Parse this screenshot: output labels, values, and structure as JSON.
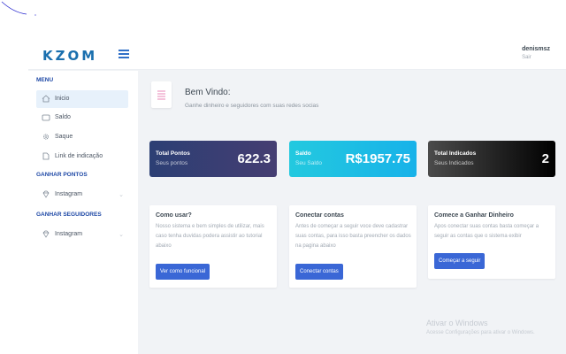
{
  "header": {
    "logo": "KZOM",
    "user_name": "denismsz",
    "user_exit": "Sair"
  },
  "sidebar": {
    "section_menu": "MENU",
    "menu_items": [
      {
        "label": "Inicio",
        "icon": "home-icon",
        "active": true
      },
      {
        "label": "Saldo",
        "icon": "wallet-icon",
        "active": false
      },
      {
        "label": "Saque",
        "icon": "gear-icon",
        "active": false
      },
      {
        "label": "Link de indicação",
        "icon": "link-icon",
        "active": false
      }
    ],
    "section_pontos": "GANHAR PONTOS",
    "pontos_items": [
      {
        "label": "Instagram",
        "icon": "diamond-icon"
      }
    ],
    "section_seguidores": "GANHAR SEGUIDORES",
    "seguidores_items": [
      {
        "label": "Instagram",
        "icon": "diamond-icon"
      }
    ]
  },
  "welcome": {
    "title": "Bem Vindo:",
    "subtitle": "Ganhe dinheiro e seguidores com suas redes socias"
  },
  "stats": [
    {
      "label": "Total Pontos",
      "sub": "Seus pontos",
      "value": "622.3"
    },
    {
      "label": "Saldo",
      "sub": "Seu Saldo",
      "value": "R$1957.75"
    },
    {
      "label": "Total Indicados",
      "sub": "Seus Indicados",
      "value": "2"
    }
  ],
  "cards": [
    {
      "title": "Como usar?",
      "text": "Nosso sistema e bem simples de utilizar, mais caso tenha duvidas podera assistir ao tutorial abaixo",
      "button": "Ver como funcional"
    },
    {
      "title": "Conectar contas",
      "text": "Antes de começar a seguir voce deve cadastrar suas contas, para isso basta preencher os dados na pagina abaixo",
      "button": "Conectar contas"
    },
    {
      "title": "Comece a Ganhar Dinheiro",
      "text": "Apos conectar suas contas basta começar a seguir as contas que o sistema exibir",
      "button": "Começar a seguir"
    }
  ],
  "activation": {
    "title": "Ativar o Windows",
    "subtitle": "Acesse Configurações para ativar o Windows."
  },
  "colors": {
    "accent": "#3a67d6",
    "menu_section": "#1f49a6",
    "active_bg": "#e7f1fb"
  }
}
